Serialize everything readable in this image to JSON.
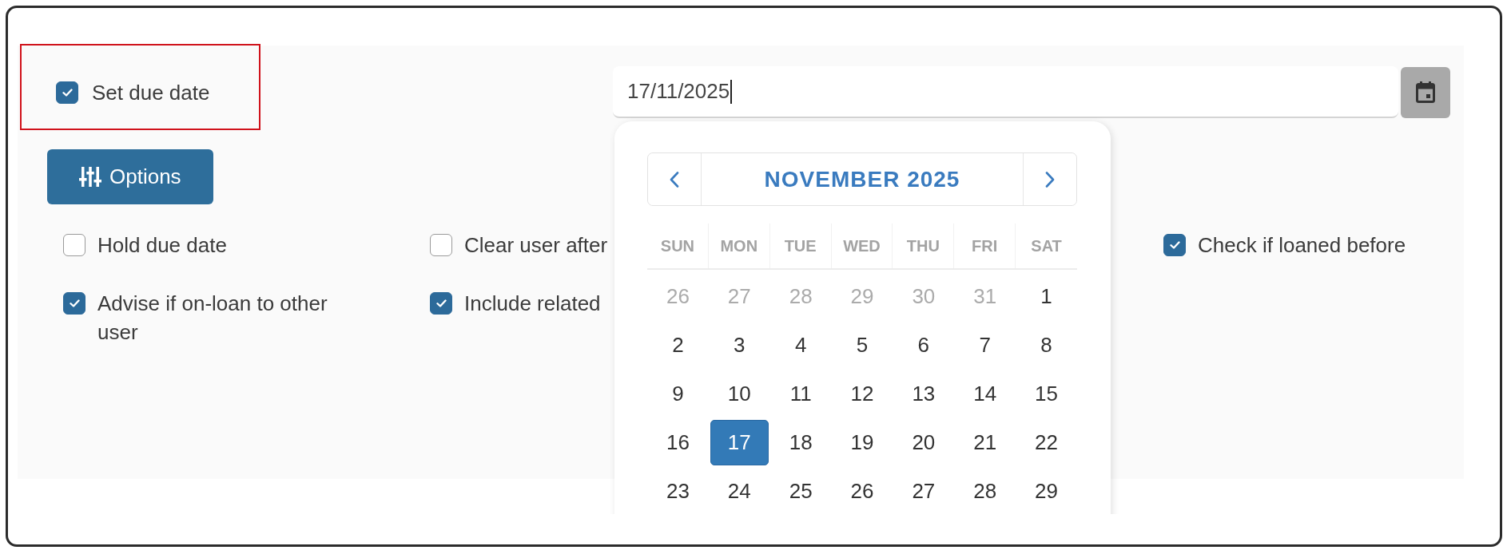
{
  "due_date": {
    "label": "Set due date",
    "checked": true
  },
  "date_field": {
    "value": "17/11/2025"
  },
  "options_button": {
    "label": "Options"
  },
  "option_columns": [
    {
      "items": [
        {
          "label": "Hold due date",
          "checked": false
        },
        {
          "label": "Advise if on-loan to other user",
          "checked": true
        }
      ]
    },
    {
      "items": [
        {
          "label": "Clear user after",
          "checked": false
        },
        {
          "label": "Include related",
          "checked": true
        }
      ]
    },
    {
      "items": [
        {
          "label": "Check if loaned before",
          "checked": true
        }
      ]
    }
  ],
  "calendar": {
    "title": "NOVEMBER 2025",
    "weekdays": [
      "SUN",
      "MON",
      "TUE",
      "WED",
      "THU",
      "FRI",
      "SAT"
    ],
    "weeks": [
      [
        {
          "label": "26",
          "other_month": true,
          "selected": false
        },
        {
          "label": "27",
          "other_month": true,
          "selected": false
        },
        {
          "label": "28",
          "other_month": true,
          "selected": false
        },
        {
          "label": "29",
          "other_month": true,
          "selected": false
        },
        {
          "label": "30",
          "other_month": true,
          "selected": false
        },
        {
          "label": "31",
          "other_month": true,
          "selected": false
        },
        {
          "label": "1",
          "other_month": false,
          "selected": false
        }
      ],
      [
        {
          "label": "2",
          "other_month": false,
          "selected": false
        },
        {
          "label": "3",
          "other_month": false,
          "selected": false
        },
        {
          "label": "4",
          "other_month": false,
          "selected": false
        },
        {
          "label": "5",
          "other_month": false,
          "selected": false
        },
        {
          "label": "6",
          "other_month": false,
          "selected": false
        },
        {
          "label": "7",
          "other_month": false,
          "selected": false
        },
        {
          "label": "8",
          "other_month": false,
          "selected": false
        }
      ],
      [
        {
          "label": "9",
          "other_month": false,
          "selected": false
        },
        {
          "label": "10",
          "other_month": false,
          "selected": false
        },
        {
          "label": "11",
          "other_month": false,
          "selected": false
        },
        {
          "label": "12",
          "other_month": false,
          "selected": false
        },
        {
          "label": "13",
          "other_month": false,
          "selected": false
        },
        {
          "label": "14",
          "other_month": false,
          "selected": false
        },
        {
          "label": "15",
          "other_month": false,
          "selected": false
        }
      ],
      [
        {
          "label": "16",
          "other_month": false,
          "selected": false
        },
        {
          "label": "17",
          "other_month": false,
          "selected": true
        },
        {
          "label": "18",
          "other_month": false,
          "selected": false
        },
        {
          "label": "19",
          "other_month": false,
          "selected": false
        },
        {
          "label": "20",
          "other_month": false,
          "selected": false
        },
        {
          "label": "21",
          "other_month": false,
          "selected": false
        },
        {
          "label": "22",
          "other_month": false,
          "selected": false
        }
      ],
      [
        {
          "label": "23",
          "other_month": false,
          "selected": false
        },
        {
          "label": "24",
          "other_month": false,
          "selected": false
        },
        {
          "label": "25",
          "other_month": false,
          "selected": false
        },
        {
          "label": "26",
          "other_month": false,
          "selected": false
        },
        {
          "label": "27",
          "other_month": false,
          "selected": false
        },
        {
          "label": "28",
          "other_month": false,
          "selected": false
        },
        {
          "label": "29",
          "other_month": false,
          "selected": false
        }
      ]
    ]
  }
}
